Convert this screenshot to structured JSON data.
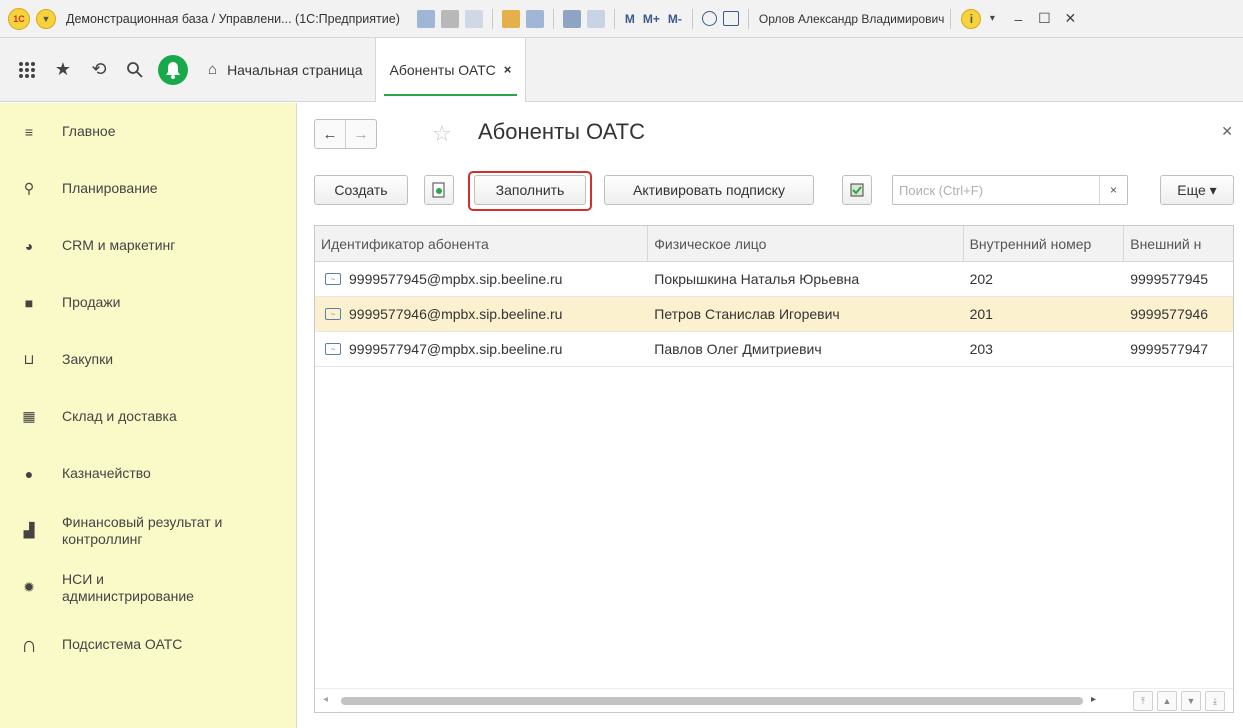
{
  "window": {
    "title": "Демонстрационная база / Управлени... (1С:Предприятие)",
    "logo_text": "1С",
    "m_labels": [
      "M",
      "M+",
      "M-"
    ],
    "user": "Орлов Александр Владимирович"
  },
  "tabs": {
    "home": "Начальная страница",
    "active": "Абоненты ОАТС",
    "close_glyph": "×"
  },
  "sidebar": {
    "items": [
      {
        "label": "Главное",
        "icon": "menu-lines-icon"
      },
      {
        "label": "Планирование",
        "icon": "planning-icon"
      },
      {
        "label": "CRM и маркетинг",
        "icon": "pie-chart-icon"
      },
      {
        "label": "Продажи",
        "icon": "shopping-bag-icon"
      },
      {
        "label": "Закупки",
        "icon": "cart-icon"
      },
      {
        "label": "Склад и доставка",
        "icon": "warehouse-icon"
      },
      {
        "label": "Казначейство",
        "icon": "ruble-icon"
      },
      {
        "label": "Финансовый результат и контроллинг",
        "icon": "bar-chart-icon"
      },
      {
        "label": "НСИ и администрирование",
        "icon": "gear-icon"
      },
      {
        "label": "Подсистема ОАТС",
        "icon": "headset-icon"
      }
    ]
  },
  "page": {
    "title": "Абоненты ОАТС"
  },
  "toolbar": {
    "create": "Создать",
    "fill": "Заполнить",
    "activate": "Активировать подписку",
    "search_placeholder": "Поиск (Ctrl+F)",
    "search_clear": "×",
    "more": "Еще ▾"
  },
  "table": {
    "columns": [
      "Идентификатор абонента",
      "Физическое лицо",
      "Внутренний номер",
      "Внешний н"
    ],
    "rows": [
      {
        "id": "9999577945@mpbx.sip.beeline.ru",
        "person": "Покрышкина Наталья Юрьевна",
        "internal": "202",
        "external": "9999577945"
      },
      {
        "id": "9999577946@mpbx.sip.beeline.ru",
        "person": "Петров Станислав Игоревич",
        "internal": "201",
        "external": "9999577946"
      },
      {
        "id": "9999577947@mpbx.sip.beeline.ru",
        "person": "Павлов Олег Дмитриевич",
        "internal": "203",
        "external": "9999577947"
      }
    ],
    "selected_row": 1
  },
  "colors": {
    "sidebar_bg": "#faf9c8",
    "highlight_border": "#d32f2f",
    "selected_row": "#fbf1cf",
    "active_tab_underline": "#2fa34a"
  }
}
